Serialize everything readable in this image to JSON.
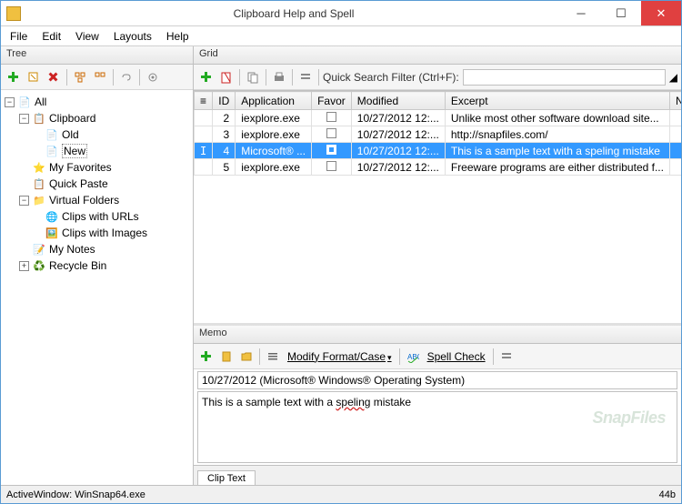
{
  "window": {
    "title": "Clipboard Help and Spell"
  },
  "menu": {
    "file": "File",
    "edit": "Edit",
    "view": "View",
    "layouts": "Layouts",
    "help": "Help"
  },
  "tree_panel": {
    "title": "Tree"
  },
  "tree": {
    "all": "All",
    "clipboard": "Clipboard",
    "old": "Old",
    "new": "New",
    "favorites": "My Favorites",
    "quickpaste": "Quick Paste",
    "vfolders": "Virtual Folders",
    "vurls": "Clips with URLs",
    "vimages": "Clips with Images",
    "notes": "My Notes",
    "recycle": "Recycle Bin"
  },
  "grid_panel": {
    "title": "Grid"
  },
  "qsf": {
    "label": "Quick Search Filter (Ctrl+F):",
    "value": ""
  },
  "grid": {
    "cols": {
      "id": "ID",
      "app": "Application",
      "favor": "Favor",
      "modified": "Modified",
      "excerpt": "Excerpt",
      "notes": "Notes"
    },
    "rows": [
      {
        "id": "2",
        "app": "iexplore.exe",
        "modified": "10/27/2012 12:...",
        "excerpt": "Unlike most other software download site..."
      },
      {
        "id": "3",
        "app": "iexplore.exe",
        "modified": "10/27/2012 12:...",
        "excerpt": "http://snapfiles.com/"
      },
      {
        "id": "4",
        "app": "Microsoft® ...",
        "modified": "10/27/2012 12:...",
        "excerpt": "This is a sample text with a speling mistake"
      },
      {
        "id": "5",
        "app": "iexplore.exe",
        "modified": "10/27/2012 12:...",
        "excerpt": "Freeware programs are either distributed f..."
      }
    ],
    "selected_index": 2
  },
  "memo_panel": {
    "title": "Memo"
  },
  "memo_toolbar": {
    "modify": "Modify Format/Case",
    "spell": "Spell Check"
  },
  "memo": {
    "title": "10/27/2012 (Microsoft® Windows® Operating System)",
    "body_pre": "This is a sample text with a ",
    "body_err": "speling",
    "body_post": " mistake"
  },
  "watermark": "SnapFiles",
  "tab": {
    "cliptext": "Clip Text"
  },
  "status": {
    "left": "ActiveWindow: WinSnap64.exe",
    "right": "44b"
  }
}
